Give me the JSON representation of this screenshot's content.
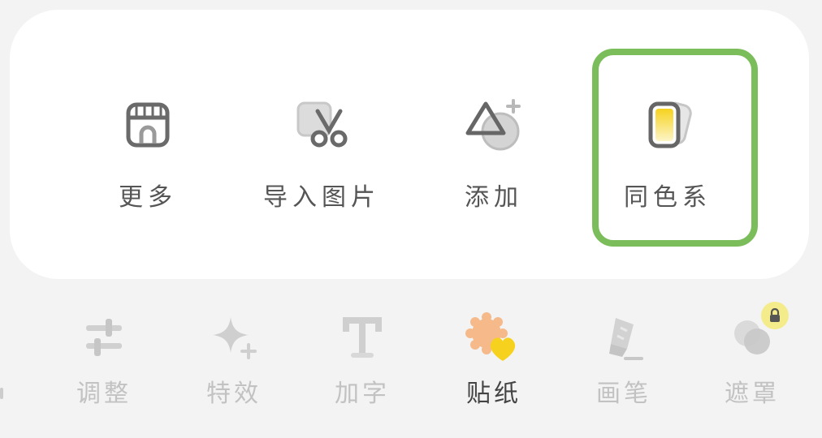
{
  "tools": [
    {
      "label": "更多",
      "icon": "store-icon"
    },
    {
      "label": "导入图片",
      "icon": "image-cut-icon"
    },
    {
      "label": "添加",
      "icon": "shape-add-icon"
    },
    {
      "label": "同色系",
      "icon": "color-family-icon"
    }
  ],
  "tabs": [
    {
      "label": "调整",
      "icon": "sliders-icon",
      "active": false
    },
    {
      "label": "特效",
      "icon": "sparkle-icon",
      "active": false
    },
    {
      "label": "加字",
      "icon": "text-icon",
      "active": false
    },
    {
      "label": "贴纸",
      "icon": "sticker-icon",
      "active": true
    },
    {
      "label": "画笔",
      "icon": "brush-icon",
      "active": false
    },
    {
      "label": "遮罩",
      "icon": "mask-icon",
      "active": false,
      "locked": true
    }
  ],
  "colors": {
    "highlight": "#7bbd5a",
    "sticker_orange": "#f5b98a",
    "sticker_yellow": "#f6d21e",
    "lock_badge": "#f4ec8a"
  }
}
